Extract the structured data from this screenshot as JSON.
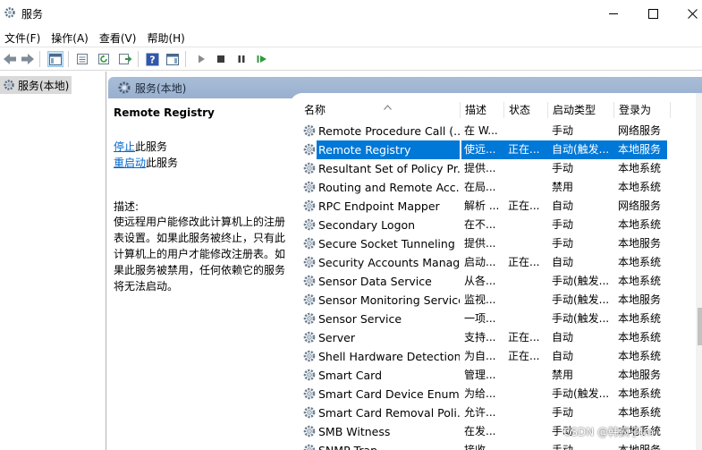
{
  "window": {
    "title": "服务",
    "minimize_glyph": "—",
    "maximize_glyph": "☐",
    "close_glyph": "✕"
  },
  "menu": [
    "文件(F)",
    "操作(A)",
    "查看(V)",
    "帮助(H)"
  ],
  "tree": {
    "item": "服务(本地)"
  },
  "right_header": {
    "title": "服务(本地)"
  },
  "details": {
    "service_name": "Remote Registry",
    "stop_link": "停止",
    "stop_suffix": "此服务",
    "restart_link": "重启动",
    "restart_suffix": "此服务",
    "desc_label": "描述:",
    "description": "使远程用户能修改此计算机上的注册表设置。如果此服务被终止，只有此计算机上的用户才能修改注册表。如果此服务被禁用，任何依赖它的服务将无法启动。"
  },
  "columns": {
    "name": "名称",
    "desc": "描述",
    "status": "状态",
    "startup": "启动类型",
    "logon": "登录为"
  },
  "rows": [
    {
      "name": "Remote Procedure Call (...",
      "desc": "在 W...",
      "status": "",
      "startup": "手动",
      "logon": "网络服务"
    },
    {
      "name": "Remote Registry",
      "desc": "使远...",
      "status": "正在...",
      "startup": "自动(触发...",
      "logon": "本地服务",
      "selected": true
    },
    {
      "name": "Resultant Set of Policy Pr...",
      "desc": "提供...",
      "status": "",
      "startup": "手动",
      "logon": "本地系统"
    },
    {
      "name": "Routing and Remote Acc...",
      "desc": "在局...",
      "status": "",
      "startup": "禁用",
      "logon": "本地系统"
    },
    {
      "name": "RPC Endpoint Mapper",
      "desc": "解析 ...",
      "status": "正在...",
      "startup": "自动",
      "logon": "网络服务"
    },
    {
      "name": "Secondary Logon",
      "desc": "在不...",
      "status": "",
      "startup": "手动",
      "logon": "本地系统"
    },
    {
      "name": "Secure Socket Tunneling ...",
      "desc": "提供...",
      "status": "",
      "startup": "手动",
      "logon": "本地服务"
    },
    {
      "name": "Security Accounts Manag...",
      "desc": "启动...",
      "status": "正在...",
      "startup": "自动",
      "logon": "本地系统"
    },
    {
      "name": "Sensor Data Service",
      "desc": "从各...",
      "status": "",
      "startup": "手动(触发...",
      "logon": "本地系统"
    },
    {
      "name": "Sensor Monitoring Service",
      "desc": "监视...",
      "status": "",
      "startup": "手动(触发...",
      "logon": "本地服务"
    },
    {
      "name": "Sensor Service",
      "desc": "一项...",
      "status": "",
      "startup": "手动(触发...",
      "logon": "本地系统"
    },
    {
      "name": "Server",
      "desc": "支持...",
      "status": "正在...",
      "startup": "自动",
      "logon": "本地系统"
    },
    {
      "name": "Shell Hardware Detection",
      "desc": "为自...",
      "status": "正在...",
      "startup": "自动",
      "logon": "本地系统"
    },
    {
      "name": "Smart Card",
      "desc": "管理...",
      "status": "",
      "startup": "禁用",
      "logon": "本地服务"
    },
    {
      "name": "Smart Card Device Enum...",
      "desc": "为给...",
      "status": "",
      "startup": "手动(触发...",
      "logon": "本地系统"
    },
    {
      "name": "Smart Card Removal Poli...",
      "desc": "允许...",
      "status": "",
      "startup": "手动",
      "logon": "本地系统"
    },
    {
      "name": "SMB Witness",
      "desc": "在发...",
      "status": "",
      "startup": "手动",
      "logon": "本地系统"
    },
    {
      "name": "SNMP Trap",
      "desc": "接收...",
      "status": "",
      "startup": "手动",
      "logon": "本地服务"
    }
  ],
  "watermark": "CSDN @韩疯子lm"
}
